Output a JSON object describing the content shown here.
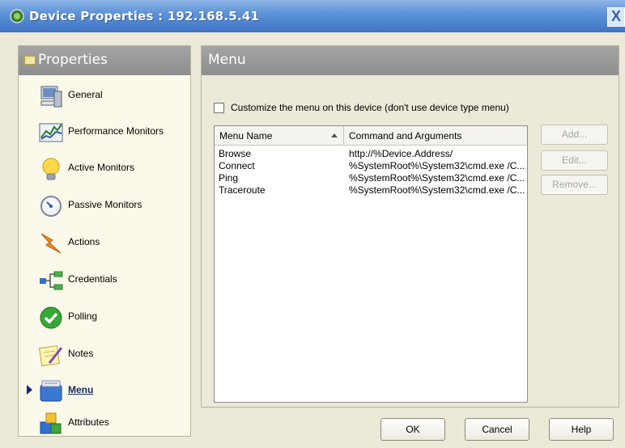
{
  "window": {
    "title": "Device Properties : 192.168.5.41",
    "close_glyph": "X"
  },
  "left_panel": {
    "header": "Properties",
    "items": [
      {
        "label": "General",
        "icon": "computer-icon"
      },
      {
        "label": "Performance Monitors",
        "icon": "chart-icon"
      },
      {
        "label": "Active Monitors",
        "icon": "lightbulb-icon"
      },
      {
        "label": "Passive Monitors",
        "icon": "gauge-icon"
      },
      {
        "label": "Actions",
        "icon": "lightning-icon"
      },
      {
        "label": "Credentials",
        "icon": "network-icon"
      },
      {
        "label": "Polling",
        "icon": "checkmark-icon"
      },
      {
        "label": "Notes",
        "icon": "notepad-icon"
      },
      {
        "label": "Menu",
        "icon": "menu-icon"
      },
      {
        "label": "Attributes",
        "icon": "blocks-icon"
      }
    ],
    "selected": "Menu"
  },
  "right_panel": {
    "header": "Menu",
    "customize_checkbox": {
      "label": "Customize the menu on this device (don't use device type menu)",
      "checked": false
    },
    "list": {
      "columns": [
        "Menu Name",
        "Command and Arguments"
      ],
      "sorted_column": "Menu Name",
      "rows": [
        {
          "name": "Browse",
          "command": "http://%Device.Address/"
        },
        {
          "name": "Connect",
          "command": "%SystemRoot%\\System32\\cmd.exe /C..."
        },
        {
          "name": "Ping",
          "command": "%SystemRoot%\\System32\\cmd.exe /C..."
        },
        {
          "name": "Traceroute",
          "command": "%SystemRoot%\\System32\\cmd.exe /C..."
        }
      ]
    },
    "buttons": {
      "add": "Add...",
      "edit": "Edit...",
      "remove": "Remove..."
    }
  },
  "dialog_buttons": {
    "ok": "OK",
    "cancel": "Cancel",
    "help": "Help"
  },
  "colors": {
    "titlebar": "#3f74c6",
    "panel_header": "#999999",
    "dialog_bg": "#ece9d8",
    "nav_bg": "#fbf9ea"
  }
}
